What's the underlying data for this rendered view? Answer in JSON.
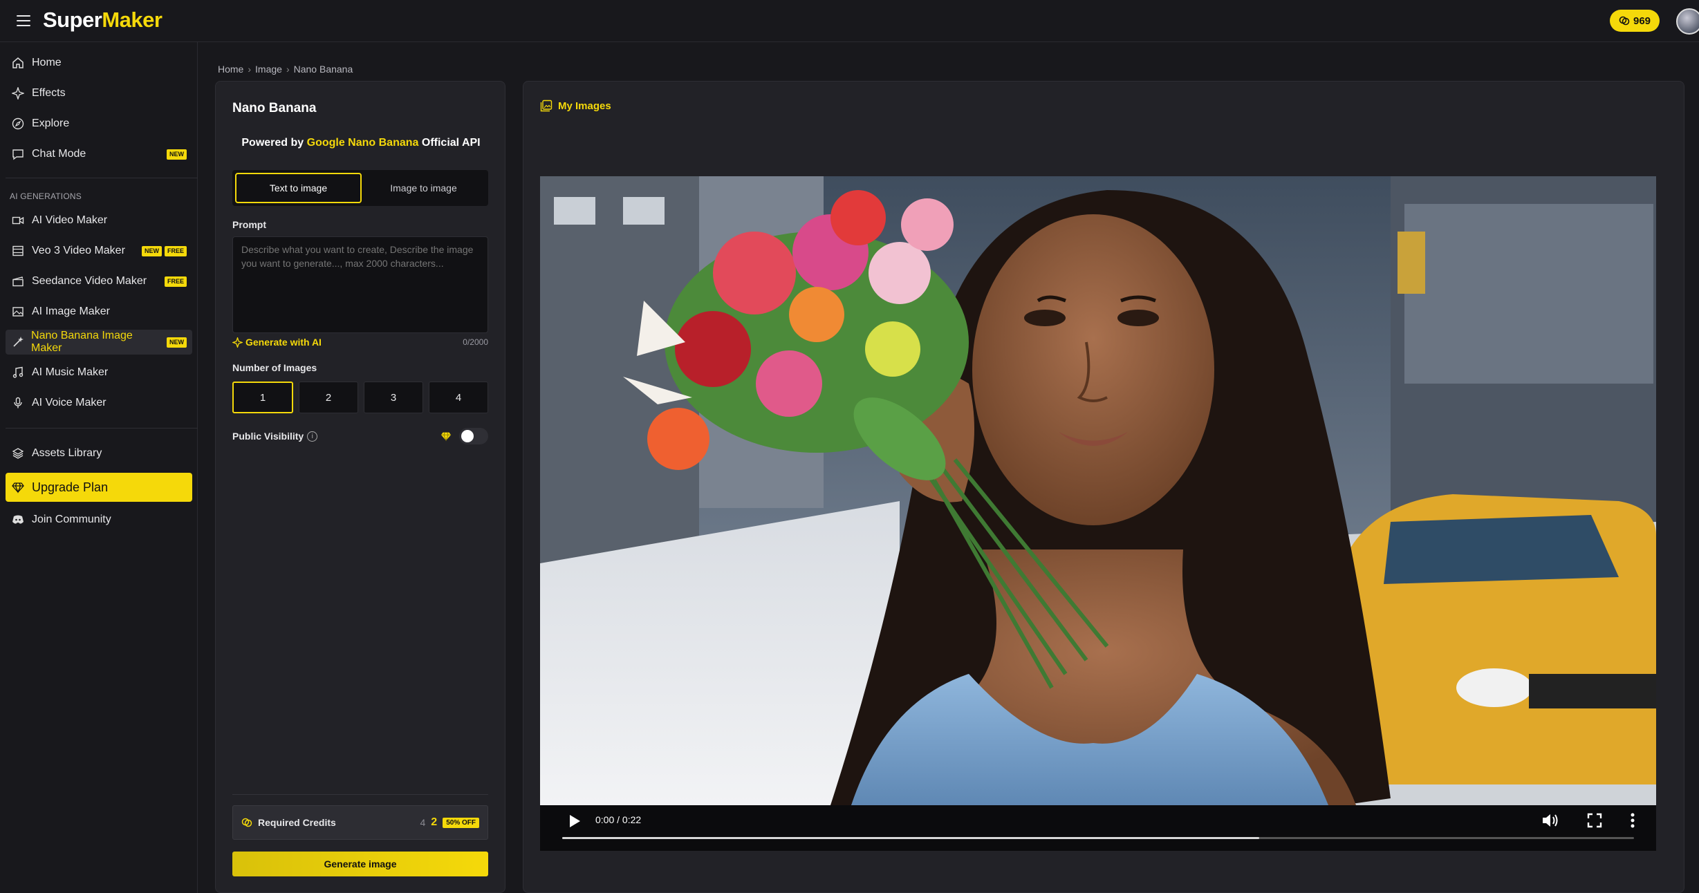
{
  "app": {
    "logo_part1": "Super",
    "logo_part2": "Maker",
    "credits": "969",
    "accent_color": "#f5d90a"
  },
  "sidebar": {
    "items": [
      {
        "label": "Home",
        "icon": "home-icon"
      },
      {
        "label": "Effects",
        "icon": "sparkles-icon"
      },
      {
        "label": "Explore",
        "icon": "compass-icon"
      },
      {
        "label": "Chat Mode",
        "icon": "chat-icon",
        "tags": [
          "NEW"
        ]
      }
    ],
    "section_title": "AI GENERATIONS",
    "gen_items": [
      {
        "label": "AI Video Maker",
        "icon": "video-camera-icon"
      },
      {
        "label": "Veo 3 Video Maker",
        "icon": "film-icon",
        "tags": [
          "NEW",
          "FREE"
        ]
      },
      {
        "label": "Seedance Video Maker",
        "icon": "clapper-icon",
        "tags": [
          "FREE"
        ]
      },
      {
        "label": "AI Image Maker",
        "icon": "image-icon"
      },
      {
        "label": "Nano Banana Image Maker",
        "icon": "magic-wand-icon",
        "tags": [
          "NEW"
        ],
        "active": true
      },
      {
        "label": "AI Music Maker",
        "icon": "music-note-icon"
      },
      {
        "label": "AI Voice Maker",
        "icon": "microphone-icon"
      }
    ],
    "assets_label": "Assets Library",
    "upgrade_label": "Upgrade Plan",
    "community_label": "Join Community"
  },
  "breadcrumb": [
    "Home",
    "Image",
    "Nano Banana"
  ],
  "panel": {
    "title": "Nano Banana",
    "powered_prefix": "Powered by ",
    "powered_highlight": "Google Nano Banana",
    "powered_suffix": " Official API",
    "tabs": [
      "Text to image",
      "Image to image"
    ],
    "active_tab": 0,
    "prompt_label": "Prompt",
    "prompt_placeholder": "Describe what you want to create, Describe the image you want to generate..., max 2000 characters...",
    "prompt_value": "",
    "generate_ai_label": "Generate with AI",
    "char_count": "0/2000",
    "num_images_label": "Number of Images",
    "num_options": [
      "1",
      "2",
      "3",
      "4"
    ],
    "num_selected": "1",
    "visibility_label": "Public Visibility",
    "visibility_on": false,
    "required_credits_label": "Required Credits",
    "credits_old": "4",
    "credits_new": "2",
    "discount_tag": "50% OFF",
    "generate_button": "Generate image"
  },
  "gallery": {
    "title": "My Images",
    "video": {
      "time_current": "0:00",
      "time_separator": " / ",
      "time_total": "0:22",
      "progress": 0.65
    }
  }
}
